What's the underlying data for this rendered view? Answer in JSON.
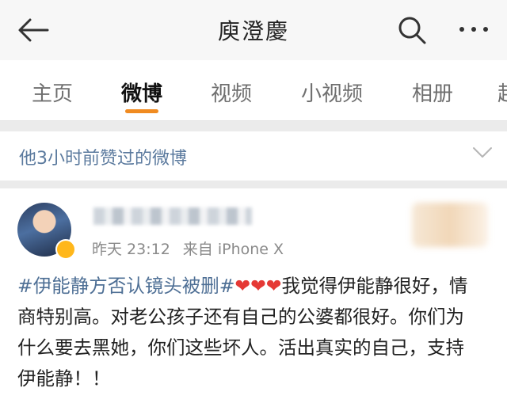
{
  "header": {
    "title": "庾澄慶"
  },
  "tabs": [
    {
      "label": "主页",
      "active": false
    },
    {
      "label": "微博",
      "active": true
    },
    {
      "label": "视频",
      "active": false
    },
    {
      "label": "小视频",
      "active": false
    },
    {
      "label": "相册",
      "active": false
    },
    {
      "label": "超",
      "active": false
    }
  ],
  "liked_bar": {
    "text": "他3小时前赞过的微博"
  },
  "post": {
    "time": "昨天 23:12",
    "source": "来自 iPhone X",
    "hashtag": "#伊能静方否认镜头被删#",
    "hearts": "❤❤❤",
    "text": "我觉得伊能静很好，情商特别高。对老公孩子还有自己的公婆都很好。你们为什么要去黑她，你们这些坏人。活出真实的自己，支持伊能静！！"
  },
  "colors": {
    "accent": "#f08b21",
    "link": "#4e6f95",
    "heart": "#e53935"
  }
}
